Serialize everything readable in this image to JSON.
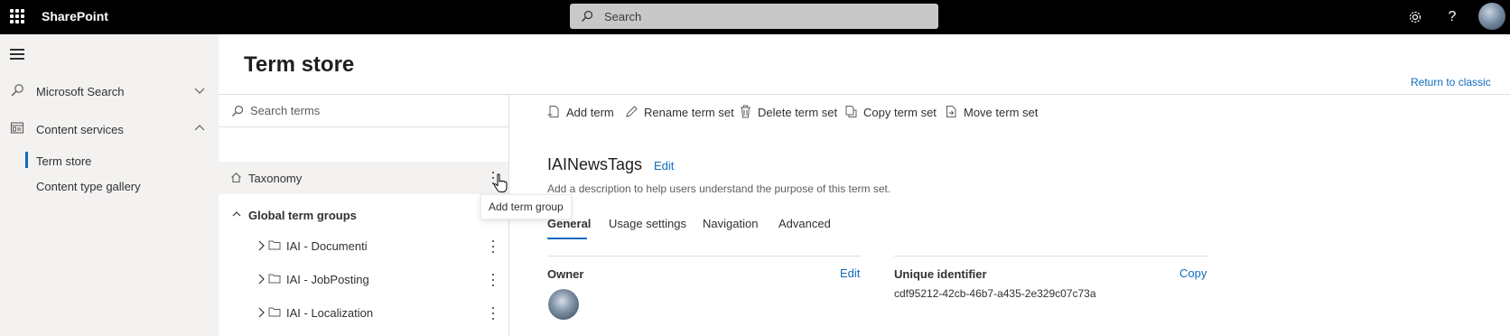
{
  "topbar": {
    "app_name": "SharePoint",
    "search_placeholder": "Search",
    "icons": [
      "waffle-icon",
      "search-icon",
      "gear-icon",
      "help-icon",
      "avatar"
    ]
  },
  "leftnav": {
    "items": [
      {
        "label": "Microsoft Search",
        "icon": "search-icon",
        "expanded": false
      },
      {
        "label": "Content services",
        "icon": "content-services-icon",
        "expanded": true
      }
    ],
    "subitems": [
      {
        "label": "Term store",
        "active": true
      },
      {
        "label": "Content type gallery",
        "active": false
      }
    ]
  },
  "header": {
    "title": "Term store",
    "return_link": "Return to classic"
  },
  "tree": {
    "search_placeholder": "Search terms",
    "root_label": "Taxonomy",
    "tooltip": "Add term group",
    "group_header": "Global term groups",
    "term_groups": [
      "IAI - Documenti",
      "IAI - JobPosting",
      "IAI - Localization"
    ]
  },
  "commands": {
    "add_term": "Add term",
    "rename_term_set": "Rename term set",
    "delete_term_set": "Delete term set",
    "copy_term_set": "Copy term set",
    "move_term_set": "Move term set"
  },
  "term_set": {
    "name": "IAINewsTags",
    "edit_label": "Edit",
    "description": "Add a description to help users understand the purpose of this term set.",
    "tabs": [
      "General",
      "Usage settings",
      "Navigation",
      "Advanced"
    ],
    "active_tab": "General",
    "owner": {
      "label": "Owner",
      "edit_label": "Edit"
    },
    "unique_identifier": {
      "label": "Unique identifier",
      "copy_label": "Copy",
      "value": "cdf95212-42cb-46b7-a435-2e329c07c73a"
    }
  },
  "colors": {
    "topbar_bg": "#000000",
    "accent": "#0f6cbd",
    "nav_bg": "#f3f2f1"
  }
}
